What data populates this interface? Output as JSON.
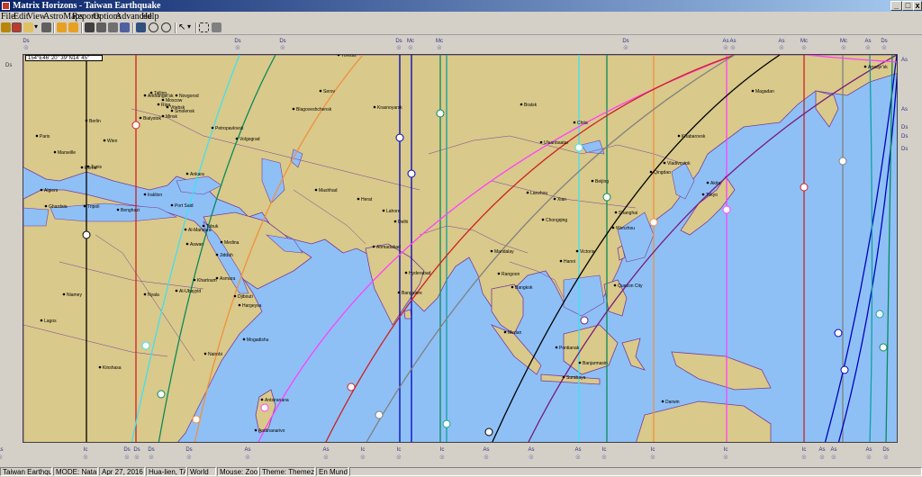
{
  "window": {
    "title": "Matrix Horizons - Taiwan Earthquake"
  },
  "menu": [
    "File",
    "Edit",
    "View",
    "AstroMaps",
    "Reports",
    "Options",
    "Advanced",
    "Help"
  ],
  "toolbar_icons": [
    "pencil-icon",
    "grid-icon",
    "edit-icon",
    "dropdown-icon",
    "print-icon",
    "chart-icon",
    "star-icon",
    "zoom-tools-icon",
    "pointer-icon",
    "settings-icon"
  ],
  "coord_readout": "154°E46' 20\"   39°N14' 45\"",
  "map": {
    "cities": [
      {
        "name": "Yoredis"
      },
      {
        "name": "Serov"
      },
      {
        "name": "Arkhangel'sk"
      },
      {
        "name": "Tallinn"
      },
      {
        "name": "Novgorod"
      },
      {
        "name": "Moscow"
      },
      {
        "name": "Riga"
      },
      {
        "name": "Vitebsk"
      },
      {
        "name": "Smolensk"
      },
      {
        "name": "Minsk"
      },
      {
        "name": "Bialystok"
      },
      {
        "name": "Berlin"
      },
      {
        "name": "Wien"
      },
      {
        "name": "Paris"
      },
      {
        "name": "Marseille"
      },
      {
        "name": "Roma"
      },
      {
        "name": "Tunis"
      },
      {
        "name": "Algiers"
      },
      {
        "name": "Ghardaia"
      },
      {
        "name": "Tripoli"
      },
      {
        "name": "Benghazi"
      },
      {
        "name": "Iraklion"
      },
      {
        "name": "Ankara"
      },
      {
        "name": "Volgograd"
      },
      {
        "name": "Petropavlovsk"
      },
      {
        "name": "Blagoveshchensk"
      },
      {
        "name": "Krasnoyarsk"
      },
      {
        "name": "Mashhad"
      },
      {
        "name": "Herat"
      },
      {
        "name": "Lahore"
      },
      {
        "name": "Delhi"
      },
      {
        "name": "Ahmadabad"
      },
      {
        "name": "Hyderabad"
      },
      {
        "name": "Bangalore"
      },
      {
        "name": "Port Said"
      },
      {
        "name": "Al-Mansura"
      },
      {
        "name": "Tabuk"
      },
      {
        "name": "Aswan"
      },
      {
        "name": "Medina"
      },
      {
        "name": "Jiddah"
      },
      {
        "name": "Khartoum"
      },
      {
        "name": "Asmara"
      },
      {
        "name": "Djibouti"
      },
      {
        "name": "Hargeysa"
      },
      {
        "name": "Nyala"
      },
      {
        "name": "Al-Ubayyid"
      },
      {
        "name": "Mogadishu"
      },
      {
        "name": "Nairobi"
      },
      {
        "name": "Niamey"
      },
      {
        "name": "Lagos"
      },
      {
        "name": "Kinshasa"
      },
      {
        "name": "Antsiranana"
      },
      {
        "name": "Antananarivo"
      },
      {
        "name": "Ulaanbaatar"
      },
      {
        "name": "Bratsk"
      },
      {
        "name": "Chita"
      },
      {
        "name": "Lanzhou"
      },
      {
        "name": "Xian"
      },
      {
        "name": "Chongqing"
      },
      {
        "name": "Beijing"
      },
      {
        "name": "Shanghai"
      },
      {
        "name": "Wenzhou"
      },
      {
        "name": "Mandalay"
      },
      {
        "name": "Rangoon"
      },
      {
        "name": "Bangkok"
      },
      {
        "name": "Hanoi"
      },
      {
        "name": "Victoria"
      },
      {
        "name": "Quezon City"
      },
      {
        "name": "Medan"
      },
      {
        "name": "Pontianak"
      },
      {
        "name": "Banjarmasin"
      },
      {
        "name": "Darwin"
      },
      {
        "name": "Khabarovsk"
      },
      {
        "name": "Vladivostok"
      },
      {
        "name": "Qingdao"
      },
      {
        "name": "Akita"
      },
      {
        "name": "Tokyo"
      },
      {
        "name": "Magadan"
      },
      {
        "name": "Anadyr'sk"
      },
      {
        "name": "Surabaya"
      }
    ]
  },
  "top_labels": [
    "Ds",
    "Ds",
    "Ds",
    "Ds",
    "Mc",
    "Mc",
    "Ds",
    "As",
    "As",
    "As",
    "Mc",
    "Mc",
    "As",
    "Ds"
  ],
  "bottom_labels": [
    "Ic",
    "Ds",
    "Ds",
    "Ds",
    "Ds",
    "As",
    "As",
    "Ic",
    "Ic",
    "Ic",
    "As",
    "As",
    "As",
    "Ic",
    "Ic",
    "Ic",
    "Ic",
    "As",
    "As",
    "As",
    "Ds",
    "As"
  ],
  "left_label": "Ds",
  "right_labels": [
    "As",
    "As",
    "Ds",
    "Ds",
    "Ds"
  ],
  "status": [
    "Taiwan Earthquake",
    "MODE: Natal",
    "Apr 27, 2016",
    "Hua-lien, TAIW",
    "World",
    "Mouse: Zoom",
    "Theme: Themez Off",
    "En Mundo"
  ],
  "colors": {
    "ocean": "#8ec0f6",
    "land": "#d9c98a",
    "border": "#7a3b9a"
  }
}
